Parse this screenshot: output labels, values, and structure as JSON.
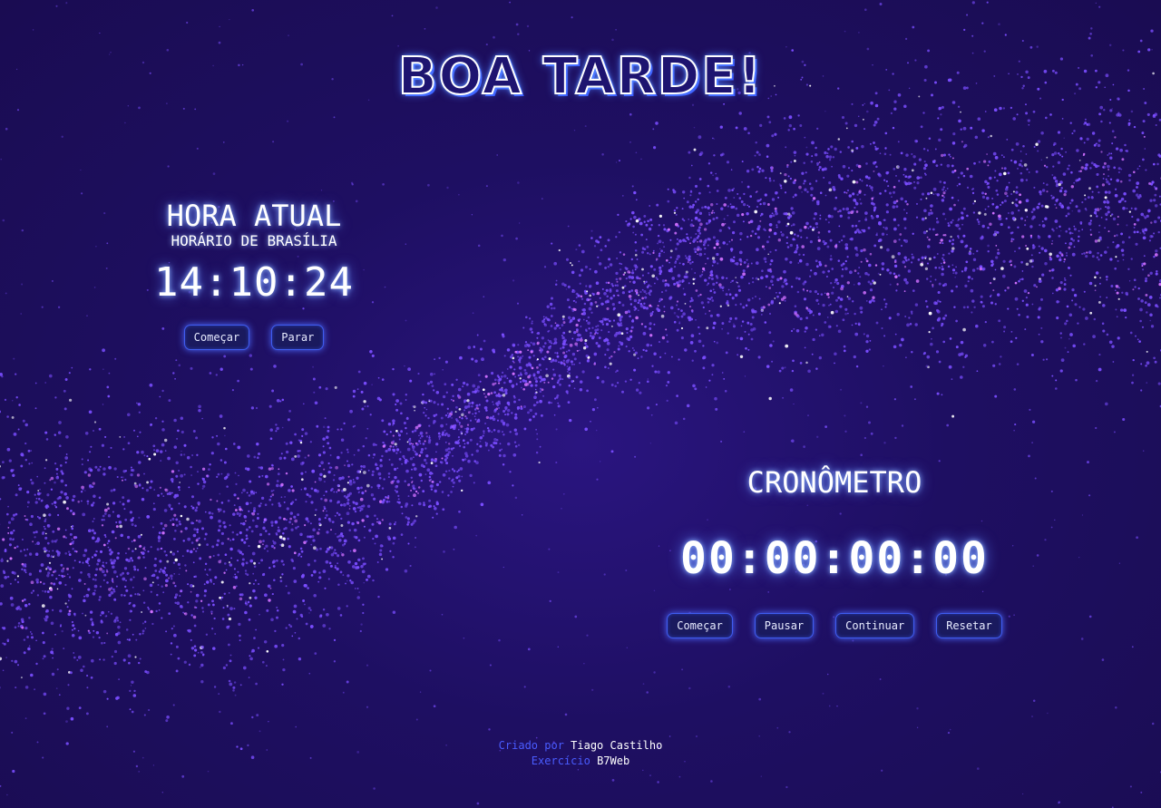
{
  "greeting": "BOA TARDE!",
  "clock": {
    "heading": "HORA ATUAL",
    "subheading": "HORÁRIO DE BRASÍLIA",
    "time": "14:10:24",
    "start_label": "Começar",
    "stop_label": "Parar"
  },
  "stopwatch": {
    "heading": "CRONÔMETRO",
    "time": "00:00:00:00",
    "start_label": "Começar",
    "pause_label": "Pausar",
    "resume_label": "Continuar",
    "reset_label": "Resetar"
  },
  "footer": {
    "created_prefix": "Criado por",
    "author": "Tiago Castilho",
    "exercise_prefix": "Exercício",
    "school": "B7Web"
  },
  "colors": {
    "background": "#1e0f62",
    "particle": "#7a4dff",
    "particle_highlight": "#d070ff",
    "accent_text": "#4a5cff",
    "button_border": "#3f5cf0"
  }
}
